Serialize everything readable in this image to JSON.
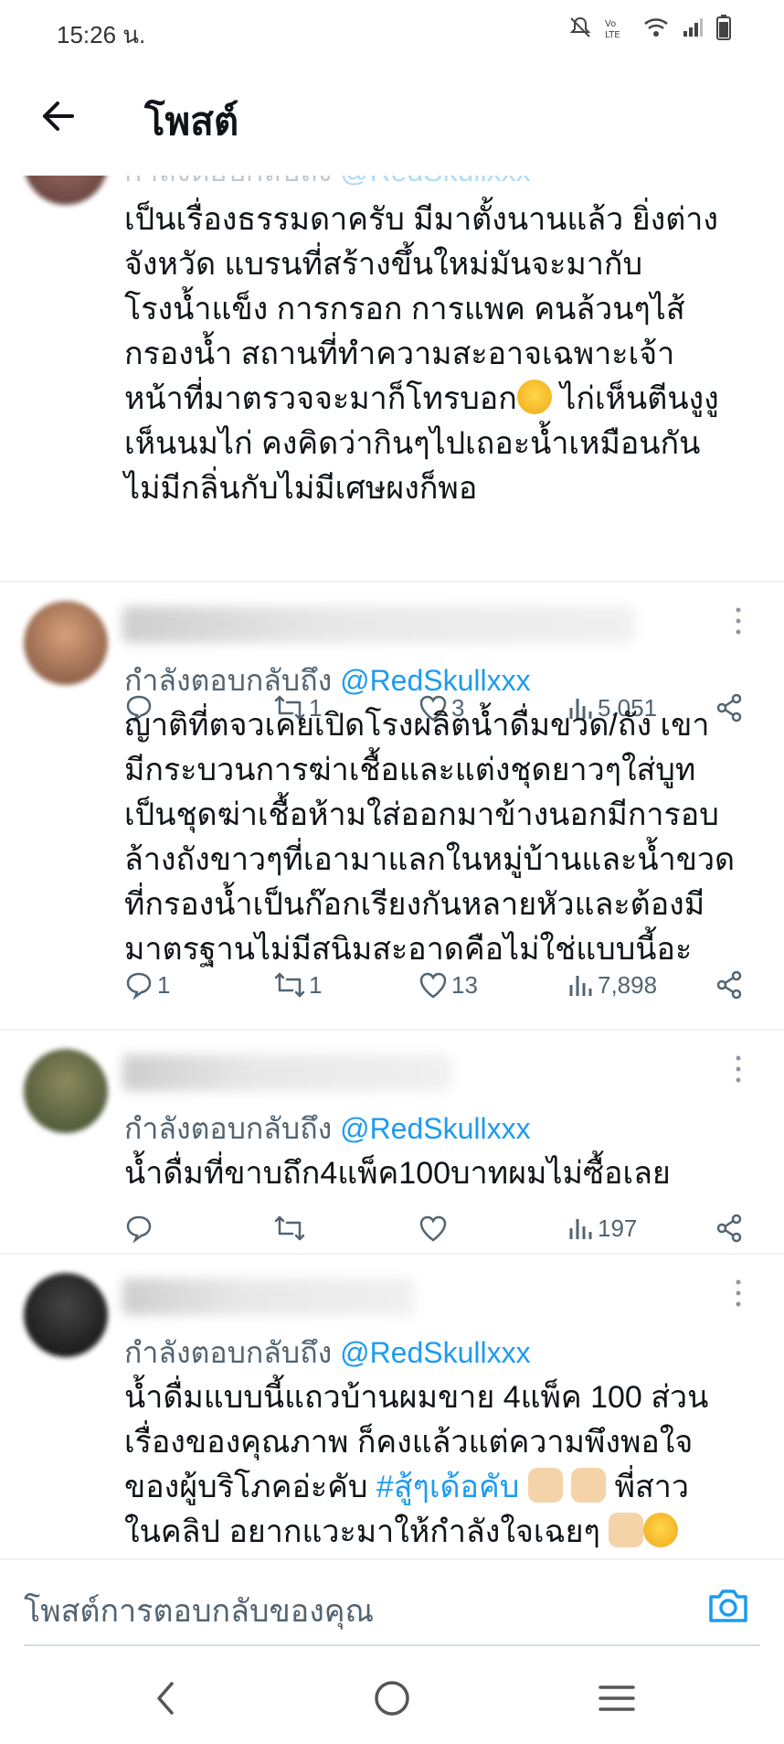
{
  "status_bar": {
    "time": "15:26 น."
  },
  "header": {
    "title": "โพสต์"
  },
  "tweets": [
    {
      "reply_prefix": "กำลังตอบกลับถึง",
      "mention": "@RedSkullxxx",
      "text": "เป็นเรื่องธรรมดาครับ มีมาตั้งนานแล้ว ยิ่งต่าง\nจังหวัด แบรนที่สร้างขึ้นใหม่มันจะมากับ\nโรงน้ำแข็ง การกรอก การแพค คนล้วนๆไส้\nกรองน้ำ สถานที่ทำความสะอาจเฉพาะเจ้า\nหน้าที่มาตรวจจะมาก็โทรบอก",
      "text_after_emoji": " ไก่เห็นตีนงูงู\nเห็นนมไก่ คงคิดว่ากินๆไปเถอะน้ำเหมือนกัน\nไม่มีกลิ่นกับไม่มีเศษผงก็พอ",
      "replies": "",
      "retweets": "1",
      "likes": "3",
      "views": "5,051"
    },
    {
      "reply_prefix": "กำลังตอบกลับถึง",
      "mention": "@RedSkullxxx",
      "text": "ญาติที่ตจวเคยเปิดโรงผลิตน้ำดื่มขวด/ถัง เขา\nมีกระบวนการฆ่าเชื้อและแต่งชุดยาวๆใส่บูท\nเป็นชุดฆ่าเชื้อห้ามใส่ออกมาข้างนอกมีการอบ\nล้างถังขาวๆที่เอามาแลกในหมู่บ้านและน้ำขวด\nที่กรองน้ำเป็นก๊อกเรียงกันหลายหัวและต้องมี\nมาตรฐานไม่มีสนิมสะอาดคือไม่ใช่แบบนี้อะ",
      "replies": "1",
      "retweets": "1",
      "likes": "13",
      "views": "7,898"
    },
    {
      "reply_prefix": "กำลังตอบกลับถึง",
      "mention": "@RedSkullxxx",
      "text": "น้ำดื่มที่ขาบถึก4แพ็ค100บาทผมไม่ซื้อเลย",
      "replies": "",
      "retweets": "",
      "likes": "",
      "views": "197"
    },
    {
      "reply_prefix": "กำลังตอบกลับถึง",
      "mention": "@RedSkullxxx",
      "text_line1": "น้ำดื่มแบบนี้แถวบ้านผมขาย 4แพ็ค 100 ส่วน",
      "text_line2": "เรื่องของคุณภาพ ก็คงแล้วแต่ความพึงพอใจ",
      "text_line3a": "ของผู้บริโภคอ่ะคับ ",
      "hashtag": "#สู้ๆเด้อคับ",
      "text_line3b": " พี่สาว",
      "text_line4": "ในคลิป  อยากแวะมาให้กำลังใจเฉยๆ "
    }
  ],
  "reply_bar": {
    "placeholder": "โพสต์การตอบกลับของคุณ"
  },
  "icons": {
    "back": "arrow-left-icon",
    "reply": "speech-bubble-icon",
    "retweet": "retweet-icon",
    "like": "heart-icon",
    "views": "bar-chart-icon",
    "share": "share-icon",
    "camera": "camera-icon"
  },
  "colors": {
    "accent": "#1d9bf0",
    "muted": "#536471",
    "text": "#0f1419"
  }
}
